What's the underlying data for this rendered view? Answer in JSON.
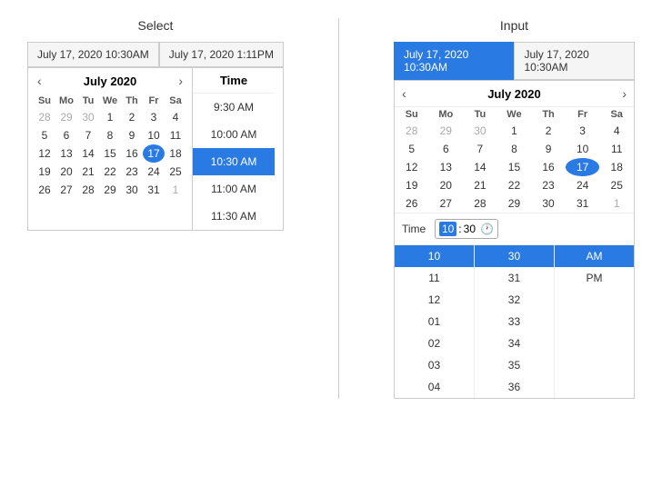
{
  "select_section": {
    "title": "Select",
    "tabs": [
      {
        "label": "July 17, 2020 10:30AM",
        "active": false
      },
      {
        "label": "July 17, 2020 1:11PM",
        "active": false
      }
    ],
    "calendar": {
      "month_year": "July 2020",
      "weekdays": [
        "Su",
        "Mo",
        "Tu",
        "We",
        "Th",
        "Fr",
        "Sa"
      ],
      "weeks": [
        [
          {
            "day": "28",
            "other": true
          },
          {
            "day": "29",
            "other": true
          },
          {
            "day": "30",
            "other": true
          },
          {
            "day": "1",
            "other": false
          },
          {
            "day": "2",
            "other": false
          },
          {
            "day": "3",
            "other": false
          },
          {
            "day": "4",
            "other": false
          }
        ],
        [
          {
            "day": "5",
            "other": false
          },
          {
            "day": "6",
            "other": false
          },
          {
            "day": "7",
            "other": false
          },
          {
            "day": "8",
            "other": false
          },
          {
            "day": "9",
            "other": false
          },
          {
            "day": "10",
            "other": false
          },
          {
            "day": "11",
            "other": false
          }
        ],
        [
          {
            "day": "12",
            "other": false
          },
          {
            "day": "13",
            "other": false
          },
          {
            "day": "14",
            "other": false
          },
          {
            "day": "15",
            "other": false
          },
          {
            "day": "16",
            "other": false
          },
          {
            "day": "17",
            "other": false,
            "selected": true
          },
          {
            "day": "18",
            "other": false
          }
        ],
        [
          {
            "day": "19",
            "other": false
          },
          {
            "day": "20",
            "other": false
          },
          {
            "day": "21",
            "other": false
          },
          {
            "day": "22",
            "other": false
          },
          {
            "day": "23",
            "other": false
          },
          {
            "day": "24",
            "other": false
          },
          {
            "day": "25",
            "other": false
          }
        ],
        [
          {
            "day": "26",
            "other": false
          },
          {
            "day": "27",
            "other": false
          },
          {
            "day": "28",
            "other": false
          },
          {
            "day": "29",
            "other": false
          },
          {
            "day": "30",
            "other": false
          },
          {
            "day": "31",
            "other": false
          },
          {
            "day": "1",
            "other": true
          }
        ]
      ]
    },
    "time_panel": {
      "header": "Time",
      "items": [
        {
          "label": "9:30 AM",
          "selected": false
        },
        {
          "label": "10:00 AM",
          "selected": false
        },
        {
          "label": "10:30 AM",
          "selected": true
        },
        {
          "label": "11:00 AM",
          "selected": false
        },
        {
          "label": "11:30 AM",
          "selected": false
        }
      ]
    }
  },
  "input_section": {
    "title": "Input",
    "tabs": [
      {
        "label": "July 17, 2020 10:30AM",
        "active": true
      },
      {
        "label": "July 17, 2020 10:30AM",
        "active": false
      }
    ],
    "calendar": {
      "month_year": "July 2020",
      "weekdays": [
        "Su",
        "Mo",
        "Tu",
        "We",
        "Th",
        "Fr",
        "Sa"
      ],
      "weeks": [
        [
          {
            "day": "28",
            "other": true
          },
          {
            "day": "29",
            "other": true
          },
          {
            "day": "30",
            "other": true
          },
          {
            "day": "1",
            "other": false
          },
          {
            "day": "2",
            "other": false
          },
          {
            "day": "3",
            "other": false
          },
          {
            "day": "4",
            "other": false
          }
        ],
        [
          {
            "day": "5",
            "other": false
          },
          {
            "day": "6",
            "other": false
          },
          {
            "day": "7",
            "other": false
          },
          {
            "day": "8",
            "other": false
          },
          {
            "day": "9",
            "other": false
          },
          {
            "day": "10",
            "other": false
          },
          {
            "day": "11",
            "other": false
          }
        ],
        [
          {
            "day": "12",
            "other": false
          },
          {
            "day": "13",
            "other": false
          },
          {
            "day": "14",
            "other": false
          },
          {
            "day": "15",
            "other": false
          },
          {
            "day": "16",
            "other": false
          },
          {
            "day": "17",
            "other": false,
            "selected": true
          },
          {
            "day": "18",
            "other": false
          }
        ],
        [
          {
            "day": "19",
            "other": false
          },
          {
            "day": "20",
            "other": false
          },
          {
            "day": "21",
            "other": false
          },
          {
            "day": "22",
            "other": false
          },
          {
            "day": "23",
            "other": false
          },
          {
            "day": "24",
            "other": false
          },
          {
            "day": "25",
            "other": false
          }
        ],
        [
          {
            "day": "26",
            "other": false
          },
          {
            "day": "27",
            "other": false
          },
          {
            "day": "28",
            "other": false
          },
          {
            "day": "29",
            "other": false
          },
          {
            "day": "30",
            "other": false
          },
          {
            "day": "31",
            "other": false
          },
          {
            "day": "1",
            "other": true
          }
        ]
      ]
    },
    "time_input": {
      "label": "Time",
      "hour": "10",
      "minute": "30",
      "separator": ":"
    },
    "hour_spinner": {
      "items": [
        {
          "label": "10",
          "selected": true
        },
        {
          "label": "11",
          "selected": false
        },
        {
          "label": "12",
          "selected": false
        },
        {
          "label": "01",
          "selected": false
        },
        {
          "label": "02",
          "selected": false
        },
        {
          "label": "03",
          "selected": false
        },
        {
          "label": "04",
          "selected": false
        }
      ]
    },
    "minute_spinner": {
      "items": [
        {
          "label": "30",
          "selected": true
        },
        {
          "label": "31",
          "selected": false
        },
        {
          "label": "32",
          "selected": false
        },
        {
          "label": "33",
          "selected": false
        },
        {
          "label": "34",
          "selected": false
        },
        {
          "label": "35",
          "selected": false
        },
        {
          "label": "36",
          "selected": false
        }
      ]
    },
    "ampm_spinner": {
      "items": [
        {
          "label": "AM",
          "selected": true
        },
        {
          "label": "PM",
          "selected": false
        }
      ]
    }
  }
}
